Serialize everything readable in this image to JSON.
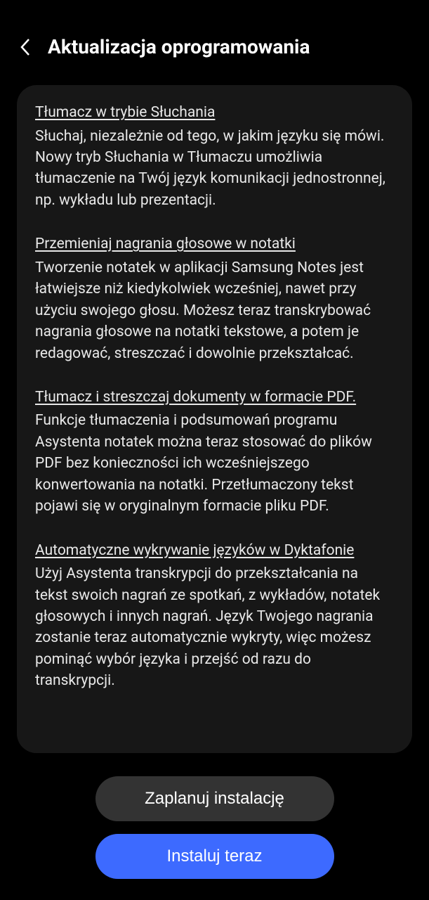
{
  "header": {
    "title": "Aktualizacja oprogramowania"
  },
  "sections": [
    {
      "heading": "Tłumacz w trybie Słuchania",
      "body": "Słuchaj, niezależnie od tego, w jakim języku się mówi. Nowy tryb Słuchania w Tłumaczu umożliwia tłumaczenie na Twój język komunikacji jednostronnej, np. wykładu lub prezentacji."
    },
    {
      "heading": "Przemieniaj nagrania głosowe w notatki",
      "body": "Tworzenie notatek w aplikacji Samsung Notes jest łatwiejsze niż kiedykolwiek wcześniej, nawet przy użyciu swojego głosu. Możesz teraz transkrybować nagrania głosowe na notatki tekstowe, a potem je redagować, streszczać i dowolnie przekształcać."
    },
    {
      "heading": "Tłumacz i streszczaj dokumenty w formacie PDF.",
      "body": "Funkcje tłumaczenia i podsumowań programu Asystenta notatek można teraz stosować do plików PDF bez konieczności ich wcześniejszego konwertowania na notatki. Przetłumaczony tekst pojawi się w oryginalnym formacie pliku PDF."
    },
    {
      "heading": "Automatyczne wykrywanie języków w Dyktafonie",
      "body": "Użyj Asystenta transkrypcji do przekształcania na tekst swoich nagrań ze spotkań, z wykładów, notatek głosowych i innych nagrań. Język Twojego nagrania zostanie teraz automatycznie wykryty, więc możesz pominąć wybór języka i przejść od razu do transkrypcji."
    }
  ],
  "footer": {
    "schedule_label": "Zaplanuj instalację",
    "install_label": "Instaluj teraz"
  }
}
